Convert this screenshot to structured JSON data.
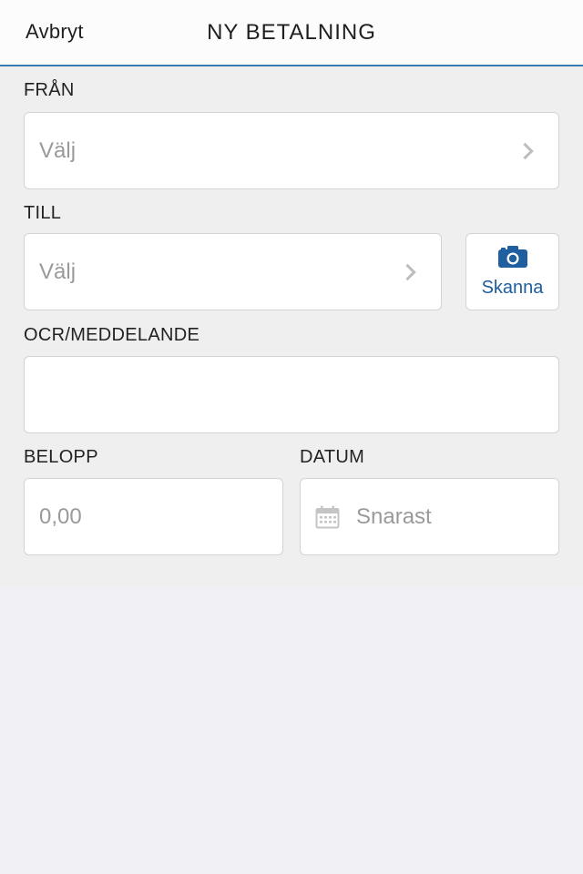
{
  "navbar": {
    "cancel_label": "Avbryt",
    "title": "NY BETALNING"
  },
  "from": {
    "label": "FRÅN",
    "placeholder": "Välj"
  },
  "to": {
    "label": "TILL",
    "placeholder": "Välj",
    "scan_label": "Skanna"
  },
  "ocr": {
    "label": "OCR/MEDDELANDE",
    "value": ""
  },
  "amount": {
    "label": "BELOPP",
    "placeholder": "0,00"
  },
  "date": {
    "label": "DATUM",
    "placeholder": "Snarast"
  },
  "colors": {
    "accent": "#1f5fa0",
    "nav_border": "#3a7bb0",
    "form_background": "#efefef",
    "page_background": "#efeff4"
  },
  "icons": {
    "chevron": "chevron-right-icon",
    "scan": "camera-icon",
    "date": "calendar-icon"
  }
}
